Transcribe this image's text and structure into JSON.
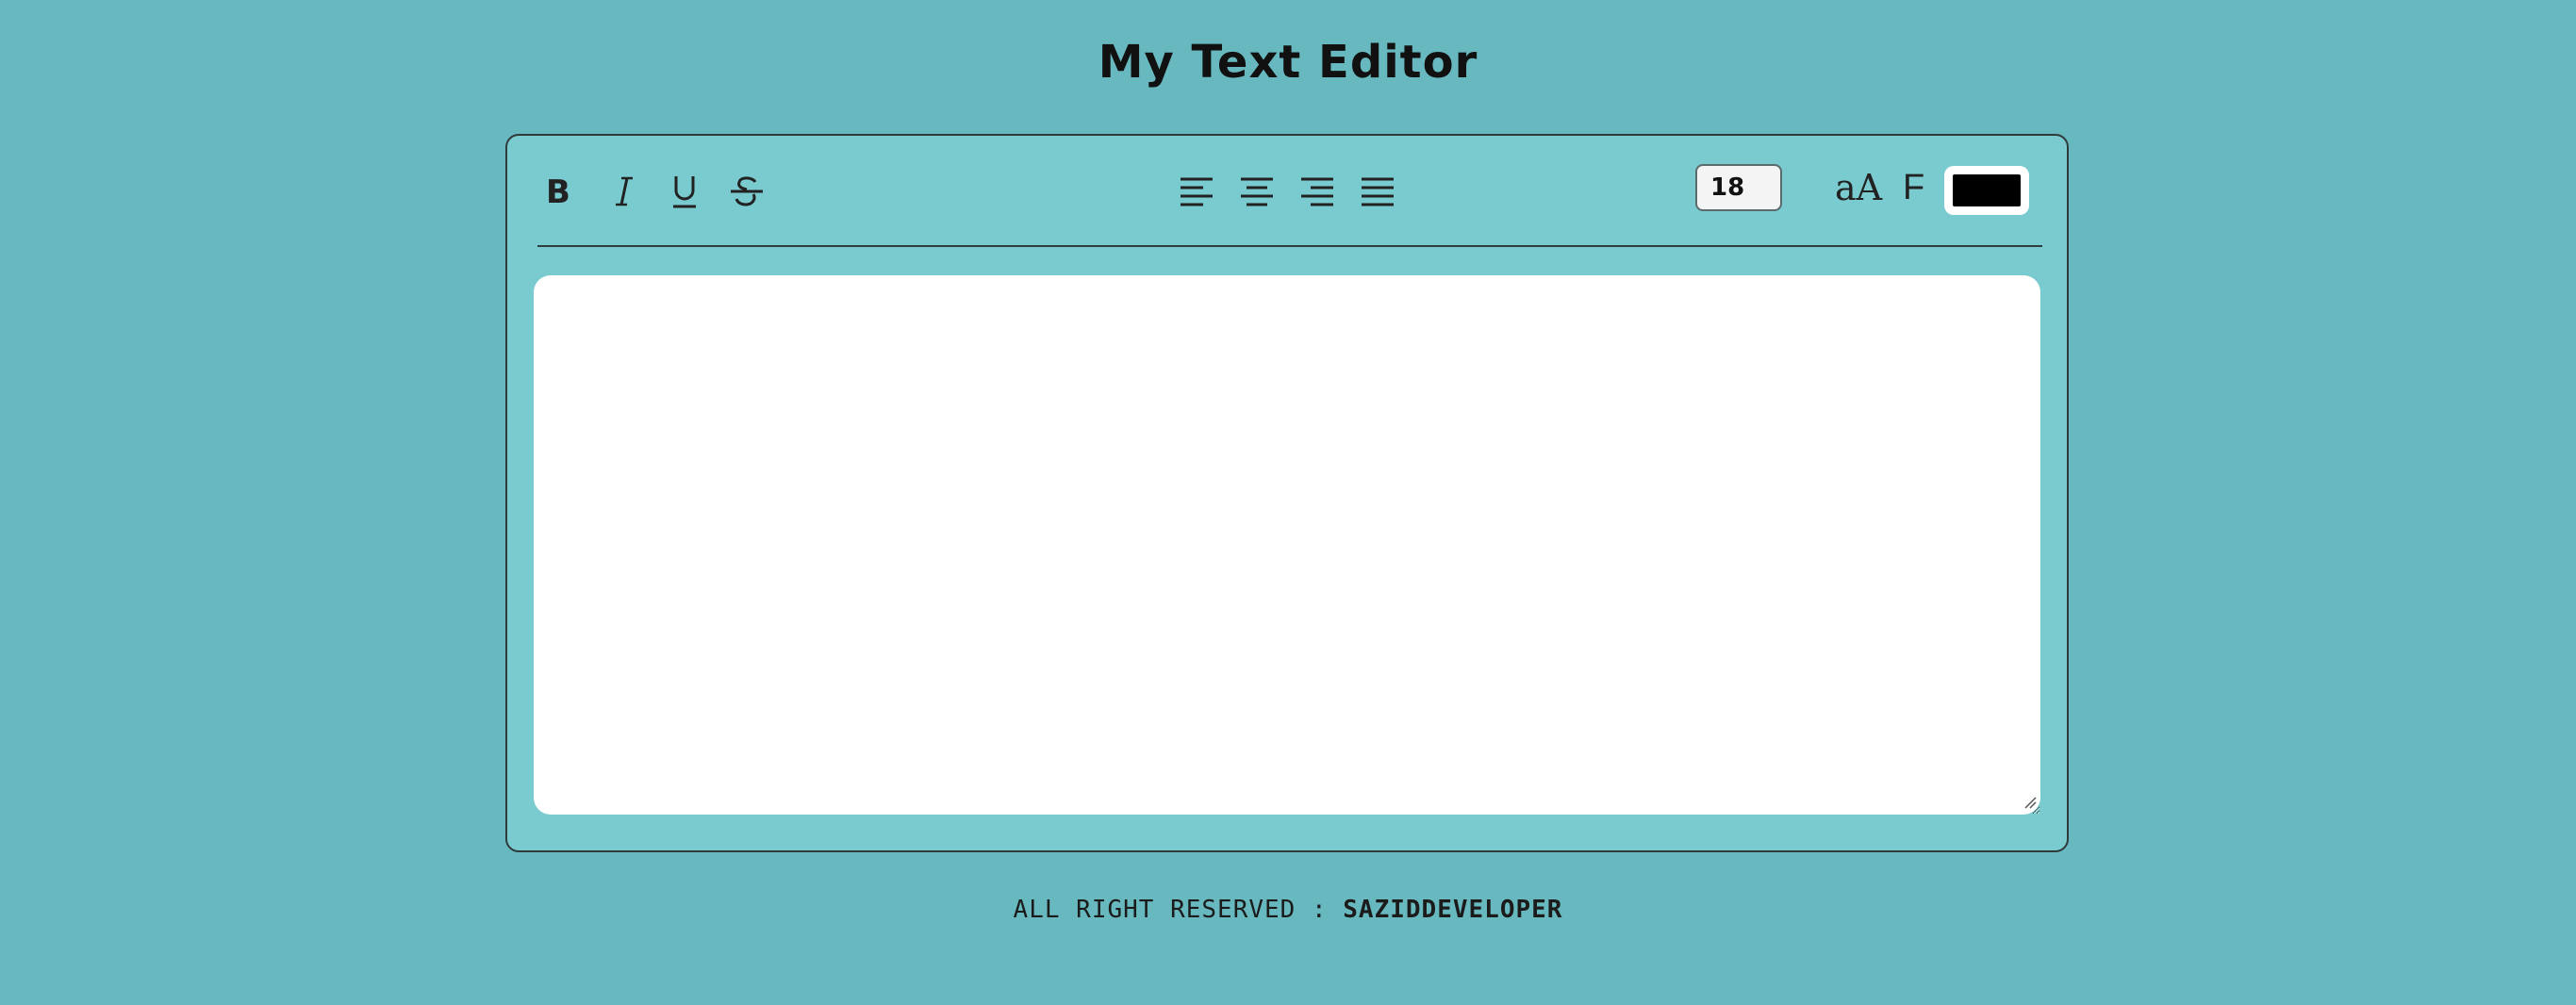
{
  "header": {
    "title": "My Text Editor"
  },
  "toolbar": {
    "format_buttons": [
      {
        "label": "B",
        "icon": "bold-icon"
      },
      {
        "label": "I",
        "icon": "italic-icon"
      },
      {
        "label": "U",
        "icon": "underline-icon"
      },
      {
        "label": "S",
        "icon": "strikethrough-icon"
      }
    ],
    "align_buttons": [
      {
        "icon": "align-left-icon"
      },
      {
        "icon": "align-center-icon"
      },
      {
        "icon": "align-right-icon"
      },
      {
        "icon": "align-justify-icon"
      }
    ],
    "font_size_value": "18",
    "font_size_icon_label": "aA",
    "font_family_icon_label": "F",
    "text_color": "#000000"
  },
  "editor": {
    "content": "",
    "placeholder": ""
  },
  "footer": {
    "prefix": "ALL RIGHT RESERVED : ",
    "brand": "SAZIDDEVELOPER"
  },
  "colors": {
    "background": "#68b9bf",
    "panel": "#79cbcf",
    "textarea": "#ffffff",
    "border": "#2f3a3b"
  }
}
